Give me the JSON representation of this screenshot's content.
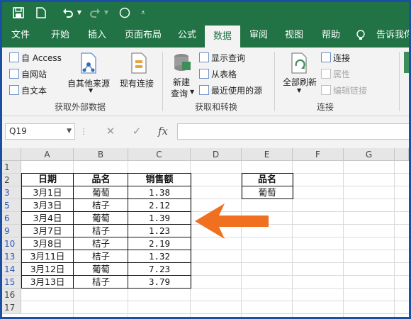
{
  "quick_access": {
    "save_icon": "save-icon",
    "new_icon": "new-doc-icon",
    "undo_icon": "undo-icon",
    "redo_icon": "redo-icon",
    "shape_icon": "circle-icon",
    "customize_icon": "customize-icon"
  },
  "tabs": [
    {
      "label": "文件"
    },
    {
      "label": "开始"
    },
    {
      "label": "插入"
    },
    {
      "label": "页面布局"
    },
    {
      "label": "公式"
    },
    {
      "label": "数据",
      "active": true
    },
    {
      "label": "审阅"
    },
    {
      "label": "视图"
    },
    {
      "label": "帮助"
    },
    {
      "label": "告诉我你"
    }
  ],
  "ribbon": {
    "get_external": {
      "from_access": "自 Access",
      "from_web": "自网站",
      "from_text": "自文本",
      "from_other": "自其他来源",
      "existing": "现有连接",
      "group_label": "获取外部数据"
    },
    "get_transform": {
      "new_query_l1": "新建",
      "new_query_l2": "查询",
      "show_queries": "显示查询",
      "from_table": "从表格",
      "recent_sources": "最近使用的源",
      "group_label": "获取和转换"
    },
    "connections": {
      "refresh_all": "全部刷新",
      "connections": "连接",
      "properties": "属性",
      "edit_links": "编辑链接",
      "group_label": "连接"
    }
  },
  "formula_bar": {
    "name_box": "Q19",
    "fx": "fx",
    "cancel": "✕",
    "enter": "✓",
    "value": ""
  },
  "sheet": {
    "columns": [
      "A",
      "B",
      "C",
      "D",
      "E",
      "F",
      "G"
    ],
    "rows": [
      "1",
      "2",
      "3",
      "5",
      "6",
      "9",
      "10",
      "13",
      "14",
      "15",
      "16",
      "17"
    ],
    "table": {
      "headers": [
        "日期",
        "品名",
        "销售额"
      ],
      "data": [
        [
          "3月1日",
          "葡萄",
          "1.38"
        ],
        [
          "3月3日",
          "桔子",
          "2.12"
        ],
        [
          "3月4日",
          "葡萄",
          "1.39"
        ],
        [
          "3月7日",
          "桔子",
          "1.23"
        ],
        [
          "3月8日",
          "桔子",
          "2.19"
        ],
        [
          "3月11日",
          "桔子",
          "1.32"
        ],
        [
          "3月12日",
          "葡萄",
          "7.23"
        ],
        [
          "3月13日",
          "桔子",
          "3.79"
        ]
      ]
    },
    "criteria": {
      "header": "品名",
      "value": "葡萄"
    }
  },
  "colors": {
    "ribbon_green": "#217346",
    "arrow_orange": "#f07020",
    "frame_blue": "#1a4fa3"
  }
}
